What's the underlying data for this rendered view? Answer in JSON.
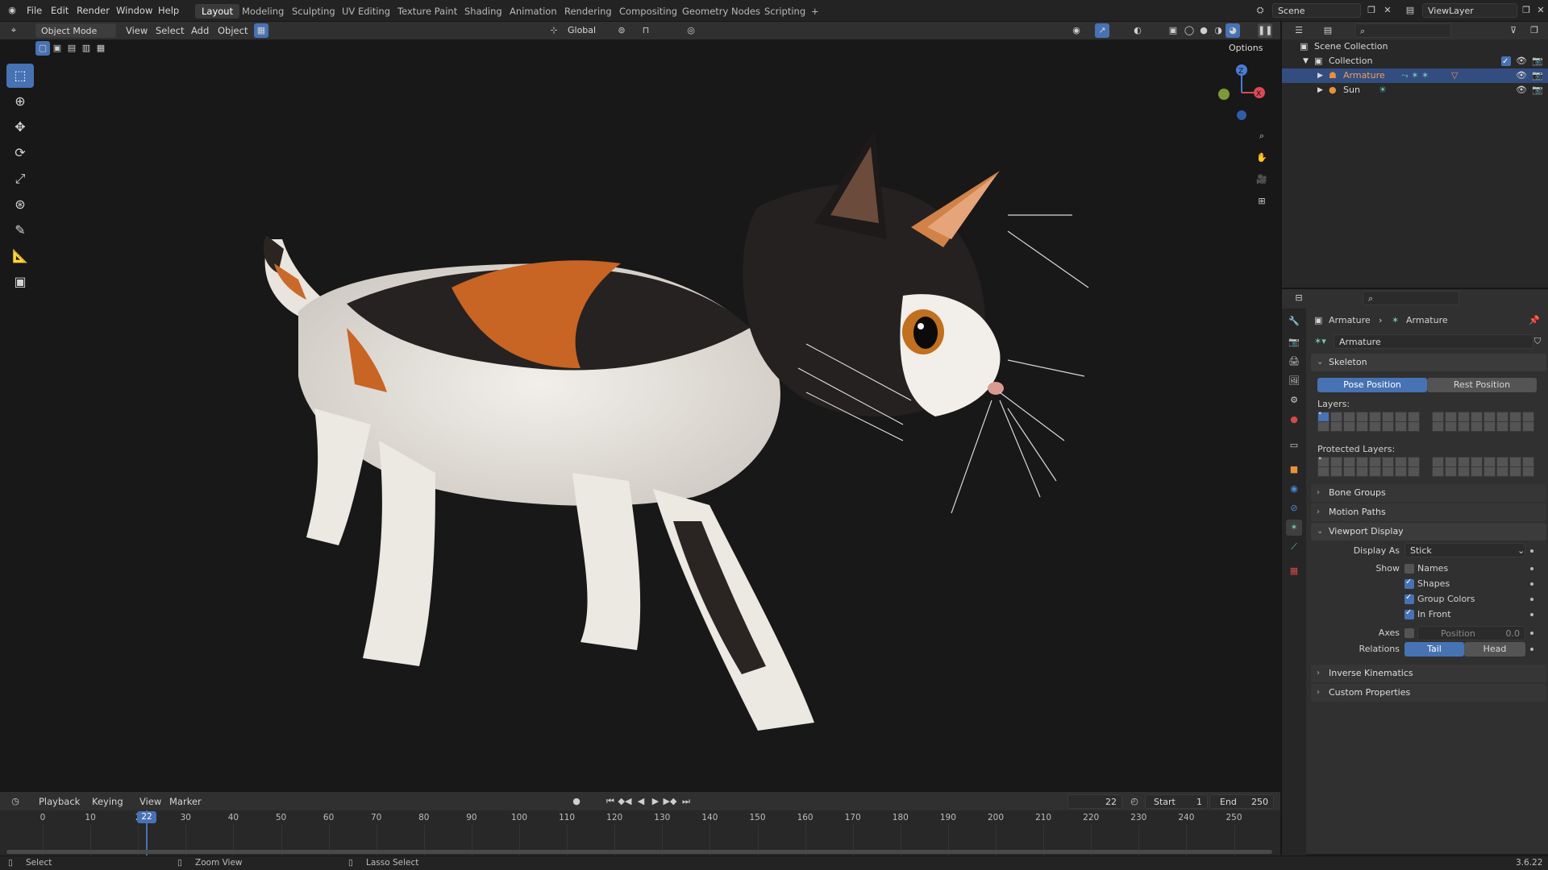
{
  "app_logo": "blender-logo-icon",
  "menu": [
    "File",
    "Edit",
    "Render",
    "Window",
    "Help"
  ],
  "workspaces": [
    "Layout",
    "Modeling",
    "Sculpting",
    "UV Editing",
    "Texture Paint",
    "Shading",
    "Animation",
    "Rendering",
    "Compositing",
    "Geometry Nodes",
    "Scripting"
  ],
  "active_workspace": "Layout",
  "add_workspace": "+",
  "scene_name": "Scene",
  "view_layer_name": "ViewLayer",
  "viewport_header": {
    "mode": "Object Mode",
    "menus": [
      "View",
      "Select",
      "Add",
      "Object"
    ],
    "transform_orientation": "Global",
    "options_label": "Options"
  },
  "gizmo_axes": {
    "z": "Z",
    "x": "X"
  },
  "tools": [
    "select-box-icon",
    "cursor-icon",
    "move-icon",
    "rotate-icon",
    "scale-icon",
    "transform-icon",
    "annotate-icon",
    "measure-icon",
    "add-cube-icon"
  ],
  "outliner": {
    "search_placeholder": "",
    "rows": [
      {
        "label": "Scene Collection",
        "indent": 0,
        "selected": false
      },
      {
        "label": "Collection",
        "indent": 1,
        "selected": false
      },
      {
        "label": "Armature",
        "indent": 2,
        "selected": true
      },
      {
        "label": "Sun",
        "indent": 2,
        "selected": false
      }
    ]
  },
  "properties": {
    "breadcrumb": [
      "Armature",
      "Armature"
    ],
    "data_name": "Armature",
    "skeleton": {
      "title": "Skeleton",
      "pose_position": "Pose Position",
      "rest_position": "Rest Position",
      "layers_label": "Layers:",
      "protected_layers_label": "Protected Layers:"
    },
    "collapsed_panels": [
      "Bone Groups",
      "Motion Paths"
    ],
    "viewport_display": {
      "title": "Viewport Display",
      "display_as_label": "Display As",
      "display_as_value": "Stick",
      "show_label": "Show",
      "show_options": [
        {
          "label": "Names",
          "checked": false
        },
        {
          "label": "Shapes",
          "checked": true
        },
        {
          "label": "Group Colors",
          "checked": true
        },
        {
          "label": "In Front",
          "checked": true
        }
      ],
      "axes_label": "Axes",
      "axes_position_label": "Position",
      "axes_position_value": "0.0",
      "relations_label": "Relations",
      "relations_tail": "Tail",
      "relations_head": "Head"
    },
    "bottom_panels": [
      "Inverse Kinematics",
      "Custom Properties"
    ]
  },
  "timeline": {
    "menus": [
      "Playback",
      "Keying",
      "View",
      "Marker"
    ],
    "current_frame": "22",
    "start_label": "Start",
    "start_value": "1",
    "end_label": "End",
    "end_value": "250",
    "ticks": [
      "0",
      "10",
      "2",
      "30",
      "40",
      "50",
      "60",
      "70",
      "80",
      "90",
      "100",
      "110",
      "120",
      "130",
      "140",
      "150",
      "160",
      "170",
      "180",
      "190",
      "200",
      "210",
      "220",
      "230",
      "240",
      "250"
    ],
    "playhead": "22"
  },
  "statusbar": {
    "items": [
      "Select",
      "Zoom View",
      "Lasso Select"
    ],
    "version": "3.6.22"
  },
  "colors": {
    "accent": "#4772b3",
    "selection": "#334d80",
    "armature_orange": "#e8913a"
  }
}
